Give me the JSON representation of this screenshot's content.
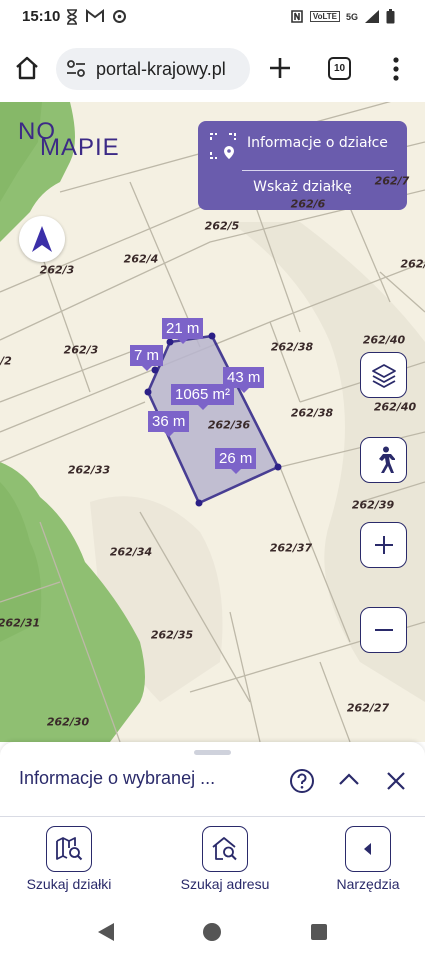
{
  "status_bar": {
    "time": "15:10",
    "volte": "VoLTE",
    "network": "5G"
  },
  "browser": {
    "url": "portal-krajowy.pl",
    "tab_count": "10"
  },
  "map": {
    "logo_top": "NO",
    "logo_bottom": "MAPIE",
    "info_panel": {
      "title": "Informacje o działce",
      "action": "Wskaż działkę"
    },
    "plots": [
      {
        "label": "262/7"
      },
      {
        "label": "262/6"
      },
      {
        "label": "262/5"
      },
      {
        "label": "262/4"
      },
      {
        "label": "262/3"
      },
      {
        "label": "262/3"
      },
      {
        "label": "262/"
      },
      {
        "label": "/2"
      },
      {
        "label": "262/38"
      },
      {
        "label": "262/38"
      },
      {
        "label": "262/40"
      },
      {
        "label": "262/40"
      },
      {
        "label": "262/36"
      },
      {
        "label": "262/33"
      },
      {
        "label": "262/39"
      },
      {
        "label": "262/34"
      },
      {
        "label": "262/37"
      },
      {
        "label": "262/31"
      },
      {
        "label": "262/35"
      },
      {
        "label": "262/30"
      },
      {
        "label": "262/27"
      }
    ],
    "measurements": [
      {
        "text": "21 m"
      },
      {
        "text": "7 m"
      },
      {
        "text": "1065 m²"
      },
      {
        "text": "43 m"
      },
      {
        "text": "36 m"
      },
      {
        "text": "26 m"
      }
    ],
    "colors": {
      "selection_fill": "#b9b6cf",
      "selection_stroke": "#2b1f86",
      "label_bg": "#7c63c9",
      "green": "#8fbf72",
      "land": "#f4f0e2"
    }
  },
  "bottom_sheet": {
    "title": "Informacje o wybranej ..."
  },
  "toolbar": {
    "search_plot": "Szukaj działki",
    "search_address": "Szukaj adresu",
    "tools": "Narzędzia"
  }
}
